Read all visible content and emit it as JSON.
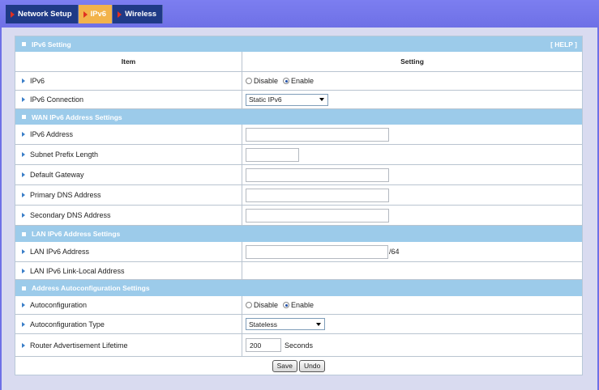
{
  "tabs": [
    {
      "label": "Network Setup",
      "active": false
    },
    {
      "label": "IPv6",
      "active": true
    },
    {
      "label": "Wireless",
      "active": false
    }
  ],
  "panel": {
    "title": "IPv6 Setting",
    "help": "[ HELP ]",
    "col_item": "Item",
    "col_setting": "Setting"
  },
  "ipv6": {
    "label": "IPv6",
    "disable": "Disable",
    "enable": "Enable",
    "selected": "Enable"
  },
  "connection": {
    "label": "IPv6 Connection",
    "value": "Static IPv6"
  },
  "wan": {
    "title": "WAN IPv6 Address Settings",
    "address_label": "IPv6 Address",
    "address_value": "",
    "prefix_label": "Subnet Prefix Length",
    "prefix_value": "",
    "gateway_label": "Default Gateway",
    "gateway_value": "",
    "dns1_label": "Primary DNS Address",
    "dns1_value": "",
    "dns2_label": "Secondary DNS Address",
    "dns2_value": ""
  },
  "lan": {
    "title": "LAN IPv6 Address Settings",
    "address_label": "LAN IPv6 Address",
    "address_value": "",
    "address_suffix": "/64",
    "linklocal_label": "LAN IPv6 Link-Local Address",
    "linklocal_value": ""
  },
  "auto": {
    "title": "Address Autoconfiguration Settings",
    "label": "Autoconfiguration",
    "disable": "Disable",
    "enable": "Enable",
    "selected": "Enable",
    "type_label": "Autoconfiguration Type",
    "type_value": "Stateless",
    "lifetime_label": "Router Advertisement Lifetime",
    "lifetime_value": "200",
    "lifetime_unit": "Seconds"
  },
  "buttons": {
    "save": "Save",
    "undo": "Undo"
  },
  "colors": {
    "topbar": "#6e70e6",
    "tab_bg": "#1f3a86",
    "tab_active": "#f2b34b",
    "section": "#9ccbea"
  }
}
